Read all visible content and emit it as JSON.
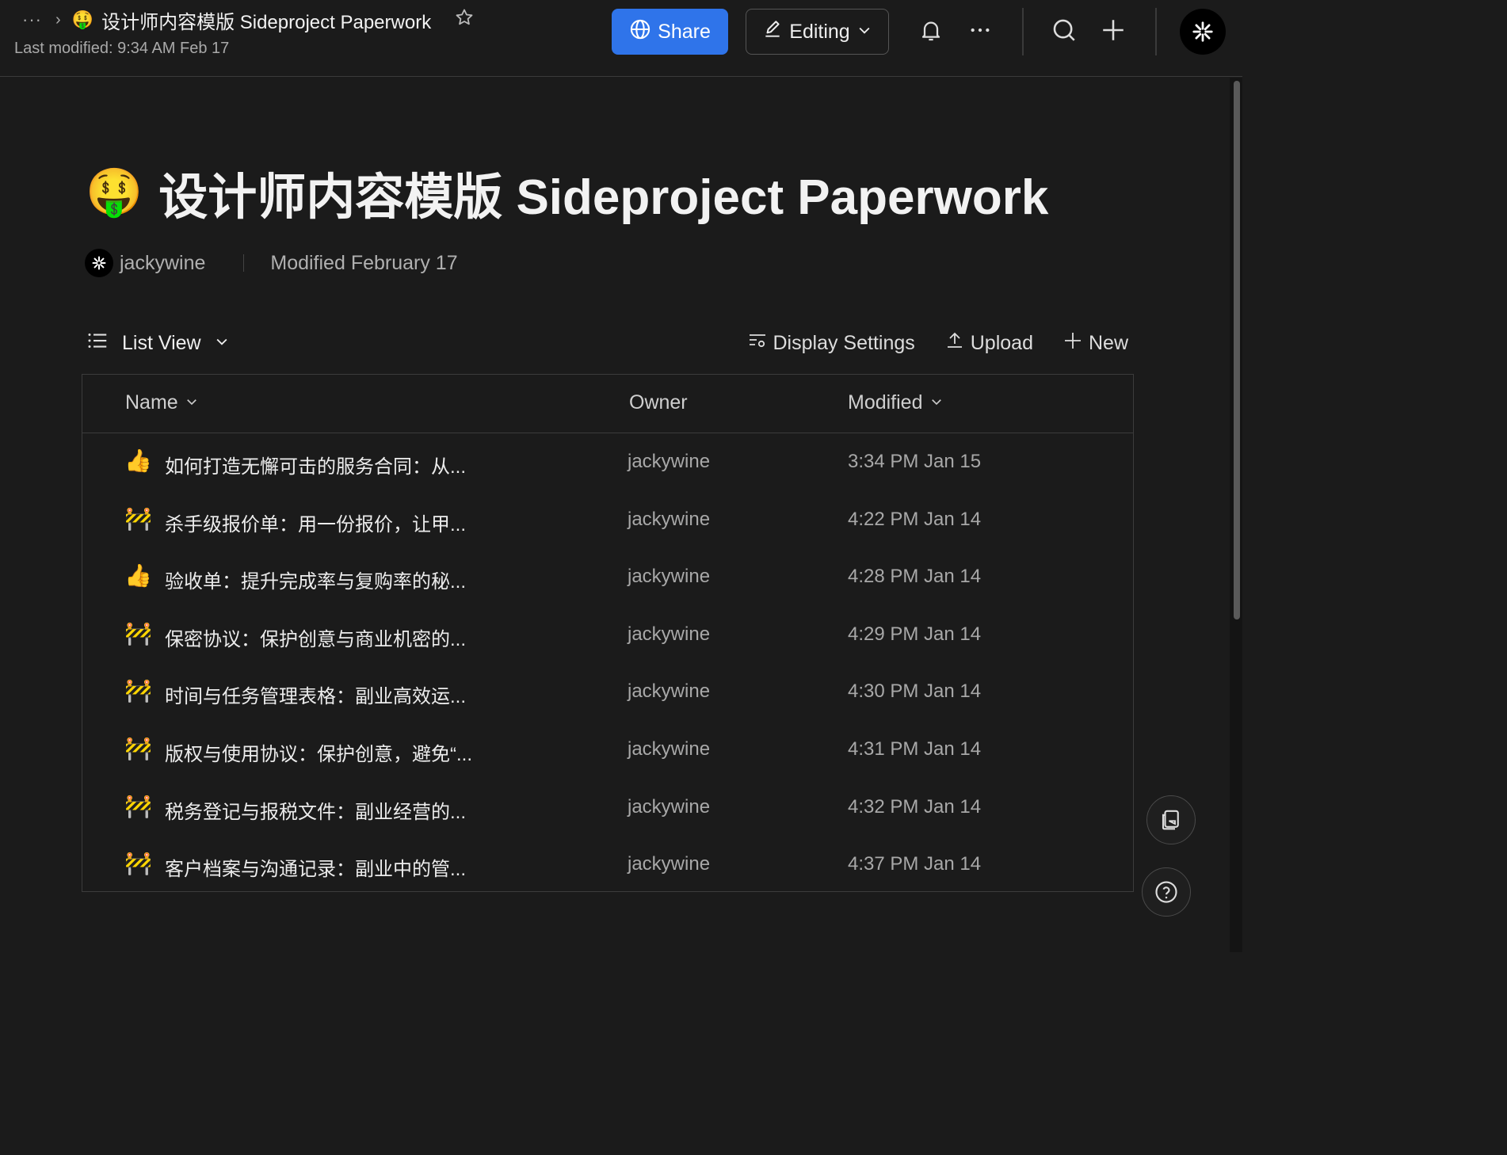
{
  "breadcrumb": {
    "more": "···",
    "separator": "›",
    "emoji": "🤑",
    "title": "设计师内容模版 Sideproject Paperwork"
  },
  "last_modified": "Last modified: 9:34 AM Feb 17",
  "header": {
    "share_label": "Share",
    "editing_label": "Editing"
  },
  "document": {
    "emoji": "🤑",
    "title": "设计师内容模版 Sideproject Paperwork",
    "owner": "jackywine",
    "modified": "Modified February 17"
  },
  "toolbar": {
    "view_label": "List View",
    "display_settings": "Display Settings",
    "upload": "Upload",
    "new": "New"
  },
  "table": {
    "columns": {
      "name": "Name",
      "owner": "Owner",
      "modified": "Modified"
    },
    "rows": [
      {
        "emoji": "👍",
        "name": "如何打造无懈可击的服务合同：从...",
        "owner": "jackywine",
        "modified": "3:34 PM Jan 15"
      },
      {
        "emoji": "🚧",
        "name": "杀手级报价单：用一份报价，让甲...",
        "owner": "jackywine",
        "modified": "4:22 PM Jan 14"
      },
      {
        "emoji": "👍",
        "name": "验收单：提升完成率与复购率的秘...",
        "owner": "jackywine",
        "modified": "4:28 PM Jan 14"
      },
      {
        "emoji": "🚧",
        "name": "保密协议：保护创意与商业机密的...",
        "owner": "jackywine",
        "modified": "4:29 PM Jan 14"
      },
      {
        "emoji": "🚧",
        "name": "时间与任务管理表格：副业高效运...",
        "owner": "jackywine",
        "modified": "4:30 PM Jan 14"
      },
      {
        "emoji": "🚧",
        "name": "版权与使用协议：保护创意，避免“...",
        "owner": "jackywine",
        "modified": "4:31 PM Jan 14"
      },
      {
        "emoji": "🚧",
        "name": "税务登记与报税文件：副业经营的...",
        "owner": "jackywine",
        "modified": "4:32 PM Jan 14"
      },
      {
        "emoji": "🚧",
        "name": "客户档案与沟通记录：副业中的管...",
        "owner": "jackywine",
        "modified": "4:37 PM Jan 14"
      }
    ]
  },
  "colors": {
    "background": "#1b1b1b",
    "accent": "#2f74ea",
    "border": "#3c3c3c",
    "muted_text": "#a8a8a8"
  },
  "icons": [
    "star-icon",
    "globe-icon",
    "pencil-icon",
    "chevron-down-icon",
    "bell-icon",
    "more-icon",
    "search-icon",
    "plus-icon",
    "list-icon",
    "settings-icon",
    "upload-icon",
    "comment-icon",
    "help-icon"
  ]
}
